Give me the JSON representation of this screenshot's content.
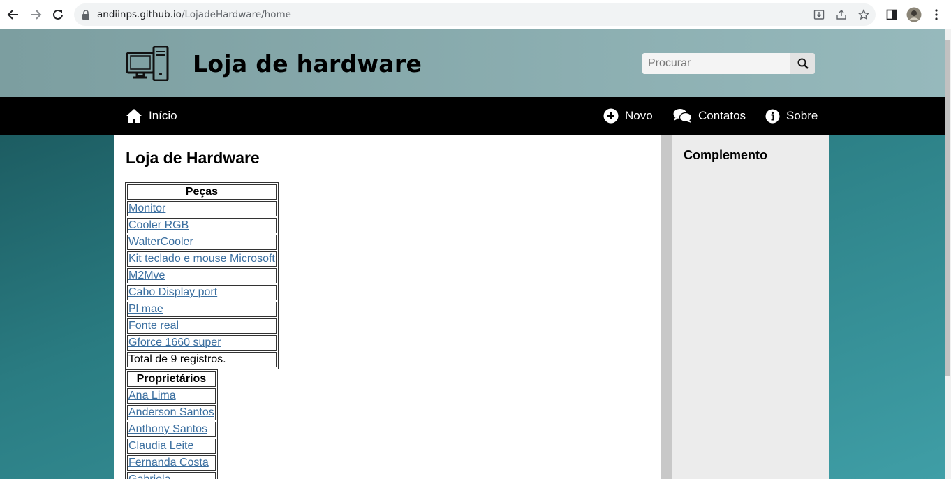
{
  "browser": {
    "url_host": "andiinps.github.io",
    "url_path": "/LojadeHardware/home"
  },
  "header": {
    "title": "Loja de hardware",
    "search_placeholder": "Procurar"
  },
  "navbar": {
    "inicio": "Início",
    "novo": "Novo",
    "contatos": "Contatos",
    "sobre": "Sobre"
  },
  "main": {
    "title": "Loja de Hardware",
    "pecas": {
      "header": "Peças",
      "items": [
        "Monitor",
        "Cooler RGB",
        "WalterCooler",
        "Kit teclado e mouse Microsoft",
        "M2Mve",
        "Cabo Display port",
        "Pl mae",
        "Fonte real",
        "Gforce 1660 super"
      ],
      "total": "Total de 9 registros."
    },
    "proprietarios": {
      "header": "Proprietários",
      "items": [
        "Ana Lima",
        "Anderson Santos",
        "Anthony Santos",
        "Claudia Leite",
        "Fernanda Costa",
        "Gabriela"
      ]
    }
  },
  "aside": {
    "title": "Complemento"
  },
  "colors": {
    "navbar": "#000000",
    "link": "#3b6fa0",
    "aside": "#ececec"
  }
}
